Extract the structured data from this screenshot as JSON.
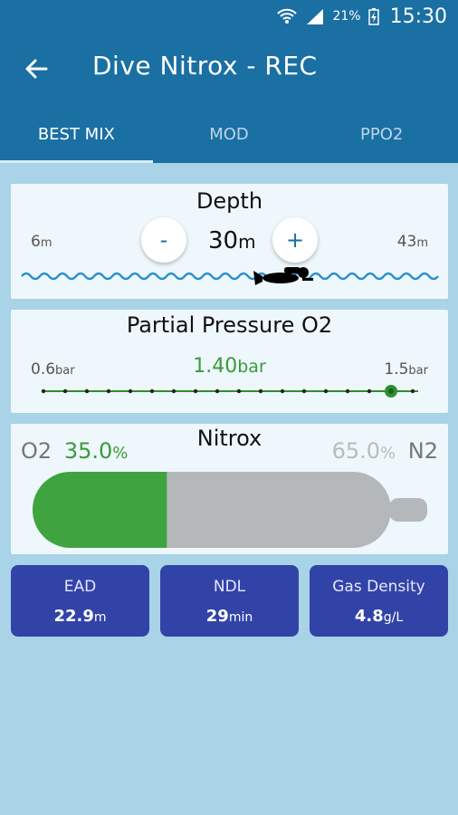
{
  "status": {
    "battery_pct": "21%",
    "time": "15:30"
  },
  "appbar": {
    "title": "Dive Nitrox - REC"
  },
  "tabs": [
    {
      "label": "BEST MIX",
      "active": true
    },
    {
      "label": "MOD",
      "active": false
    },
    {
      "label": "PPO2",
      "active": false
    }
  ],
  "depth": {
    "title": "Depth",
    "min_value": "6",
    "min_unit": "m",
    "max_value": "43",
    "max_unit": "m",
    "value": "30",
    "unit": "m",
    "minus_label": "-",
    "plus_label": "+"
  },
  "ppo2": {
    "title": "Partial Pressure O2",
    "min_value": "0.6",
    "min_unit": "bar",
    "max_value": "1.5",
    "max_unit": "bar",
    "value": "1.40",
    "unit": "bar",
    "slider_steps": 18,
    "slider_selected_index": 16
  },
  "nitrox": {
    "title": "Nitrox",
    "o2_label": "O2",
    "o2_value": "35.0",
    "o2_unit": "%",
    "n2_label": "N2",
    "n2_value": "65.0",
    "n2_unit": "%",
    "o2_fraction": 0.35,
    "colors": {
      "o2": "#3fa43f",
      "n2": "#b5b8ba"
    }
  },
  "metrics": [
    {
      "label": "EAD",
      "value": "22.9",
      "unit": "m"
    },
    {
      "label": "NDL",
      "value": "29",
      "unit": "min"
    },
    {
      "label": "Gas Density",
      "value": "4.8",
      "unit": "g/L"
    }
  ],
  "colors": {
    "primary": "#1a6fa3",
    "background": "#a9d3e6",
    "card": "#eef7fb",
    "metric_bg": "#3243a8",
    "accent_green": "#3a9a3a"
  }
}
